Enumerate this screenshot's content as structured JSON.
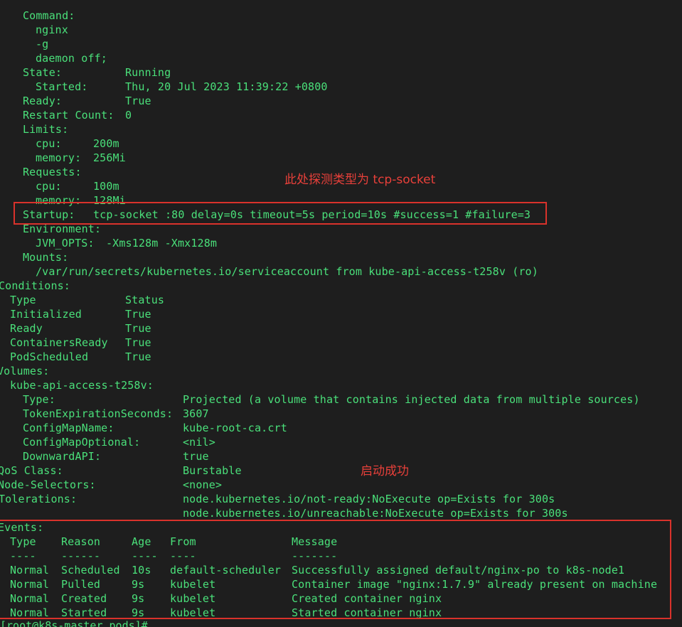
{
  "lines": {
    "l0": "Command:",
    "l1": "nginx",
    "l2": "-g",
    "l3": "daemon off;",
    "l4k": "State:",
    "l4v": "Running",
    "l5k": "Started:",
    "l5v": "Thu, 20 Jul 2023 11:39:22 +0800",
    "l6k": "Ready:",
    "l6v": "True",
    "l7k": "Restart Count:",
    "l7v": "0",
    "l8": "Limits:",
    "l9k": "cpu:",
    "l9v": "200m",
    "l10k": "memory:",
    "l10v": "256Mi",
    "l11": "Requests:",
    "l12k": "cpu:",
    "l12v": "100m",
    "l13k": "memory:",
    "l13v": "128Mi",
    "l14k": "Startup:",
    "l14v": "tcp-socket :80 delay=0s timeout=5s period=10s #success=1 #failure=3",
    "l15": "Environment:",
    "l16k": "JVM_OPTS:",
    "l16v": "-Xms128m -Xmx128m",
    "l17": "Mounts:",
    "l18": "/var/run/secrets/kubernetes.io/serviceaccount from kube-api-access-t258v (ro)",
    "l19": "Conditions:",
    "l20k": "Type",
    "l20v": "Status",
    "l21k": "Initialized",
    "l21v": "True",
    "l22k": "Ready",
    "l22v": "True",
    "l23k": "ContainersReady",
    "l23v": "True",
    "l24k": "PodScheduled",
    "l24v": "True",
    "l25": "Volumes:",
    "l26": "kube-api-access-t258v:",
    "l27k": "Type:",
    "l27v": "Projected (a volume that contains injected data from multiple sources)",
    "l28k": "TokenExpirationSeconds:",
    "l28v": "3607",
    "l29k": "ConfigMapName:",
    "l29v": "kube-root-ca.crt",
    "l30k": "ConfigMapOptional:",
    "l30v": "<nil>",
    "l31k": "DownwardAPI:",
    "l31v": "true",
    "l32k": "QoS Class:",
    "l32v": "Burstable",
    "l33k": "Node-Selectors:",
    "l33v": "<none>",
    "l34k": "Tolerations:",
    "l34v": "node.kubernetes.io/not-ready:NoExecute op=Exists for 300s",
    "l35v": "node.kubernetes.io/unreachable:NoExecute op=Exists for 300s",
    "l36": "Events:"
  },
  "events": {
    "headers": [
      "Type",
      "Reason",
      "Age",
      "From",
      "Message"
    ],
    "dashes": [
      "----",
      "------",
      "----",
      "----",
      "-------"
    ],
    "rows": [
      [
        "Normal",
        "Scheduled",
        "10s",
        "default-scheduler",
        "Successfully assigned default/nginx-po to k8s-node1"
      ],
      [
        "Normal",
        "Pulled",
        "9s",
        "kubelet",
        "Container image \"nginx:1.7.9\" already present on machine"
      ],
      [
        "Normal",
        "Created",
        "9s",
        "kubelet",
        "Created container nginx"
      ],
      [
        "Normal",
        "Started",
        "9s",
        "kubelet",
        "Started container nginx"
      ]
    ]
  },
  "annotations": {
    "probe_note": "此处探测类型为 tcp-socket",
    "success_note": "启动成功"
  },
  "prompt_fragment": "[root@k8s-master pods]# ",
  "colors": {
    "background": "#1e1e1e",
    "text": "#4ae07a",
    "annotation": "#e8403a",
    "highlight_box": "#d9322b"
  }
}
